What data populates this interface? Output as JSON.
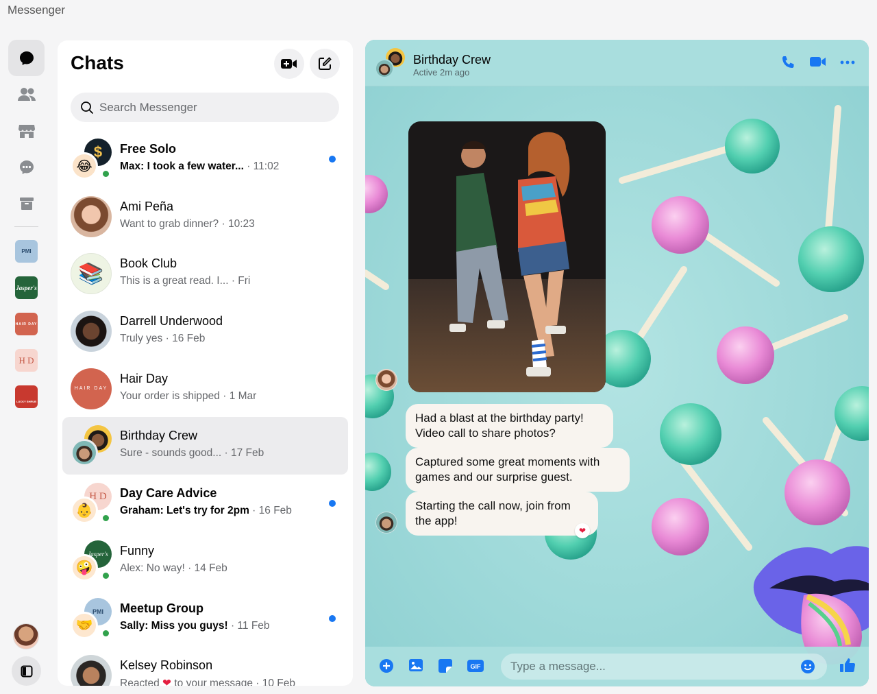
{
  "app": {
    "title": "Messenger"
  },
  "colors": {
    "accent": "#1877f2",
    "online": "#31a24c",
    "heart": "#e41e3f"
  },
  "rail": {
    "items": [
      {
        "name": "chats",
        "icon": "chat-bubble-icon",
        "active": true
      },
      {
        "name": "people",
        "icon": "people-icon"
      },
      {
        "name": "marketplace",
        "icon": "store-icon"
      },
      {
        "name": "message-requests",
        "icon": "chat-dots-icon"
      },
      {
        "name": "archive",
        "icon": "archive-icon"
      }
    ],
    "businesses": [
      {
        "name": "pmi",
        "text": "PMI"
      },
      {
        "name": "jaspers",
        "text": "Jasper's"
      },
      {
        "name": "hair-day",
        "text": "HAIR DAY"
      },
      {
        "name": "hd",
        "text": "H D"
      },
      {
        "name": "lucky-shrub",
        "text": "LUCKY SHRUB"
      }
    ]
  },
  "chats": {
    "title": "Chats",
    "search_placeholder": "Search Messenger",
    "items": [
      {
        "name": "Free Solo",
        "preview": "Max: I took a few water...",
        "time": "11:02",
        "unread": true
      },
      {
        "name": "Ami Peña",
        "preview": "Want to grab dinner?",
        "time": "10:23"
      },
      {
        "name": "Book Club",
        "preview": "This is a great read. I...",
        "time": "Fri"
      },
      {
        "name": "Darrell Underwood",
        "preview": "Truly yes",
        "time": "16 Feb"
      },
      {
        "name": "Hair Day",
        "preview": "Your order is shipped",
        "time": "1 Mar",
        "avatar_text": "HAIR DAY"
      },
      {
        "name": "Birthday Crew",
        "preview": "Sure - sounds good...",
        "time": "17 Feb",
        "selected": true
      },
      {
        "name": "Day Care Advice",
        "preview": "Graham: Let's try for 2pm",
        "time": "16 Feb",
        "unread": true,
        "avatar_text": "H D"
      },
      {
        "name": "Funny",
        "preview": "Alex: No way!",
        "time": "14 Feb",
        "avatar_text": "Jasper's"
      },
      {
        "name": "Meetup Group",
        "preview": "Sally: Miss you guys!",
        "time": "11 Feb",
        "unread": true,
        "avatar_text": "PMI"
      },
      {
        "name": "Kelsey Robinson",
        "preview_before": "Reacted",
        "preview_after": "to your message",
        "time": "10 Feb"
      }
    ]
  },
  "conversation": {
    "name": "Birthday Crew",
    "status": "Active 2m ago",
    "messages": [
      {
        "text": "Had a blast at the birthday party! Video call to share photos?"
      },
      {
        "text": "Captured some great moments with games and our surprise guest."
      },
      {
        "text": "Starting the call now, join from the app!",
        "reaction": "heart"
      }
    ],
    "composer_placeholder": "Type a message...",
    "gif_label": "GIF"
  }
}
